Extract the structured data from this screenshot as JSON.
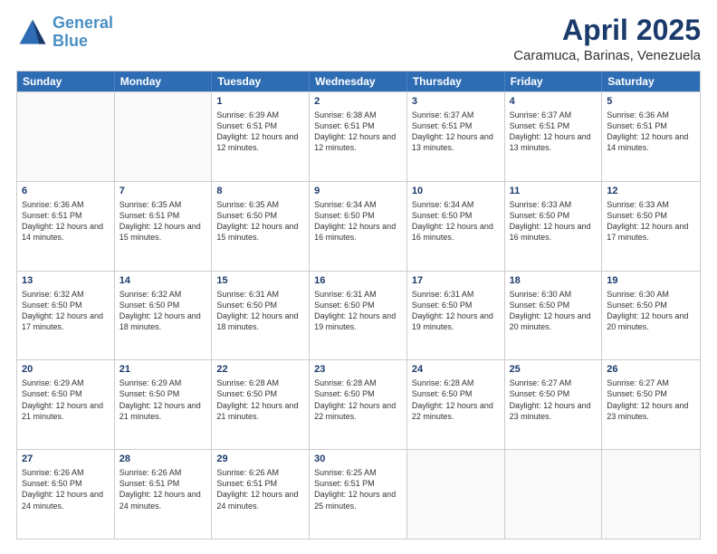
{
  "logo": {
    "line1": "General",
    "line2": "Blue"
  },
  "title": "April 2025",
  "subtitle": "Caramuca, Barinas, Venezuela",
  "days_of_week": [
    "Sunday",
    "Monday",
    "Tuesday",
    "Wednesday",
    "Thursday",
    "Friday",
    "Saturday"
  ],
  "weeks": [
    [
      {
        "day": "",
        "sunrise": "",
        "sunset": "",
        "daylight": ""
      },
      {
        "day": "",
        "sunrise": "",
        "sunset": "",
        "daylight": ""
      },
      {
        "day": "1",
        "sunrise": "Sunrise: 6:39 AM",
        "sunset": "Sunset: 6:51 PM",
        "daylight": "Daylight: 12 hours and 12 minutes."
      },
      {
        "day": "2",
        "sunrise": "Sunrise: 6:38 AM",
        "sunset": "Sunset: 6:51 PM",
        "daylight": "Daylight: 12 hours and 12 minutes."
      },
      {
        "day": "3",
        "sunrise": "Sunrise: 6:37 AM",
        "sunset": "Sunset: 6:51 PM",
        "daylight": "Daylight: 12 hours and 13 minutes."
      },
      {
        "day": "4",
        "sunrise": "Sunrise: 6:37 AM",
        "sunset": "Sunset: 6:51 PM",
        "daylight": "Daylight: 12 hours and 13 minutes."
      },
      {
        "day": "5",
        "sunrise": "Sunrise: 6:36 AM",
        "sunset": "Sunset: 6:51 PM",
        "daylight": "Daylight: 12 hours and 14 minutes."
      }
    ],
    [
      {
        "day": "6",
        "sunrise": "Sunrise: 6:36 AM",
        "sunset": "Sunset: 6:51 PM",
        "daylight": "Daylight: 12 hours and 14 minutes."
      },
      {
        "day": "7",
        "sunrise": "Sunrise: 6:35 AM",
        "sunset": "Sunset: 6:51 PM",
        "daylight": "Daylight: 12 hours and 15 minutes."
      },
      {
        "day": "8",
        "sunrise": "Sunrise: 6:35 AM",
        "sunset": "Sunset: 6:50 PM",
        "daylight": "Daylight: 12 hours and 15 minutes."
      },
      {
        "day": "9",
        "sunrise": "Sunrise: 6:34 AM",
        "sunset": "Sunset: 6:50 PM",
        "daylight": "Daylight: 12 hours and 16 minutes."
      },
      {
        "day": "10",
        "sunrise": "Sunrise: 6:34 AM",
        "sunset": "Sunset: 6:50 PM",
        "daylight": "Daylight: 12 hours and 16 minutes."
      },
      {
        "day": "11",
        "sunrise": "Sunrise: 6:33 AM",
        "sunset": "Sunset: 6:50 PM",
        "daylight": "Daylight: 12 hours and 16 minutes."
      },
      {
        "day": "12",
        "sunrise": "Sunrise: 6:33 AM",
        "sunset": "Sunset: 6:50 PM",
        "daylight": "Daylight: 12 hours and 17 minutes."
      }
    ],
    [
      {
        "day": "13",
        "sunrise": "Sunrise: 6:32 AM",
        "sunset": "Sunset: 6:50 PM",
        "daylight": "Daylight: 12 hours and 17 minutes."
      },
      {
        "day": "14",
        "sunrise": "Sunrise: 6:32 AM",
        "sunset": "Sunset: 6:50 PM",
        "daylight": "Daylight: 12 hours and 18 minutes."
      },
      {
        "day": "15",
        "sunrise": "Sunrise: 6:31 AM",
        "sunset": "Sunset: 6:50 PM",
        "daylight": "Daylight: 12 hours and 18 minutes."
      },
      {
        "day": "16",
        "sunrise": "Sunrise: 6:31 AM",
        "sunset": "Sunset: 6:50 PM",
        "daylight": "Daylight: 12 hours and 19 minutes."
      },
      {
        "day": "17",
        "sunrise": "Sunrise: 6:31 AM",
        "sunset": "Sunset: 6:50 PM",
        "daylight": "Daylight: 12 hours and 19 minutes."
      },
      {
        "day": "18",
        "sunrise": "Sunrise: 6:30 AM",
        "sunset": "Sunset: 6:50 PM",
        "daylight": "Daylight: 12 hours and 20 minutes."
      },
      {
        "day": "19",
        "sunrise": "Sunrise: 6:30 AM",
        "sunset": "Sunset: 6:50 PM",
        "daylight": "Daylight: 12 hours and 20 minutes."
      }
    ],
    [
      {
        "day": "20",
        "sunrise": "Sunrise: 6:29 AM",
        "sunset": "Sunset: 6:50 PM",
        "daylight": "Daylight: 12 hours and 21 minutes."
      },
      {
        "day": "21",
        "sunrise": "Sunrise: 6:29 AM",
        "sunset": "Sunset: 6:50 PM",
        "daylight": "Daylight: 12 hours and 21 minutes."
      },
      {
        "day": "22",
        "sunrise": "Sunrise: 6:28 AM",
        "sunset": "Sunset: 6:50 PM",
        "daylight": "Daylight: 12 hours and 21 minutes."
      },
      {
        "day": "23",
        "sunrise": "Sunrise: 6:28 AM",
        "sunset": "Sunset: 6:50 PM",
        "daylight": "Daylight: 12 hours and 22 minutes."
      },
      {
        "day": "24",
        "sunrise": "Sunrise: 6:28 AM",
        "sunset": "Sunset: 6:50 PM",
        "daylight": "Daylight: 12 hours and 22 minutes."
      },
      {
        "day": "25",
        "sunrise": "Sunrise: 6:27 AM",
        "sunset": "Sunset: 6:50 PM",
        "daylight": "Daylight: 12 hours and 23 minutes."
      },
      {
        "day": "26",
        "sunrise": "Sunrise: 6:27 AM",
        "sunset": "Sunset: 6:50 PM",
        "daylight": "Daylight: 12 hours and 23 minutes."
      }
    ],
    [
      {
        "day": "27",
        "sunrise": "Sunrise: 6:26 AM",
        "sunset": "Sunset: 6:50 PM",
        "daylight": "Daylight: 12 hours and 24 minutes."
      },
      {
        "day": "28",
        "sunrise": "Sunrise: 6:26 AM",
        "sunset": "Sunset: 6:51 PM",
        "daylight": "Daylight: 12 hours and 24 minutes."
      },
      {
        "day": "29",
        "sunrise": "Sunrise: 6:26 AM",
        "sunset": "Sunset: 6:51 PM",
        "daylight": "Daylight: 12 hours and 24 minutes."
      },
      {
        "day": "30",
        "sunrise": "Sunrise: 6:25 AM",
        "sunset": "Sunset: 6:51 PM",
        "daylight": "Daylight: 12 hours and 25 minutes."
      },
      {
        "day": "",
        "sunrise": "",
        "sunset": "",
        "daylight": ""
      },
      {
        "day": "",
        "sunrise": "",
        "sunset": "",
        "daylight": ""
      },
      {
        "day": "",
        "sunrise": "",
        "sunset": "",
        "daylight": ""
      }
    ]
  ]
}
